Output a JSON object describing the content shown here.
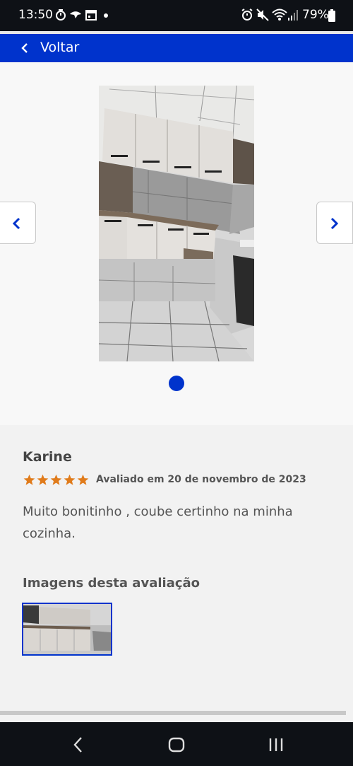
{
  "status_bar": {
    "time": "13:50",
    "battery": "79%"
  },
  "header": {
    "back_label": "Voltar"
  },
  "gallery": {
    "current_index": 1,
    "total_images": 1
  },
  "review": {
    "name": "Karine",
    "rating": 5,
    "date_text": "Avaliado em 20 de novembro de 2023",
    "text": "Muito bonitinho , coube certinho na minha cozinha.",
    "images_heading": "Imagens desta avaliação"
  },
  "colors": {
    "brand_blue": "#0033cc",
    "star_orange": "#e07b1b"
  }
}
